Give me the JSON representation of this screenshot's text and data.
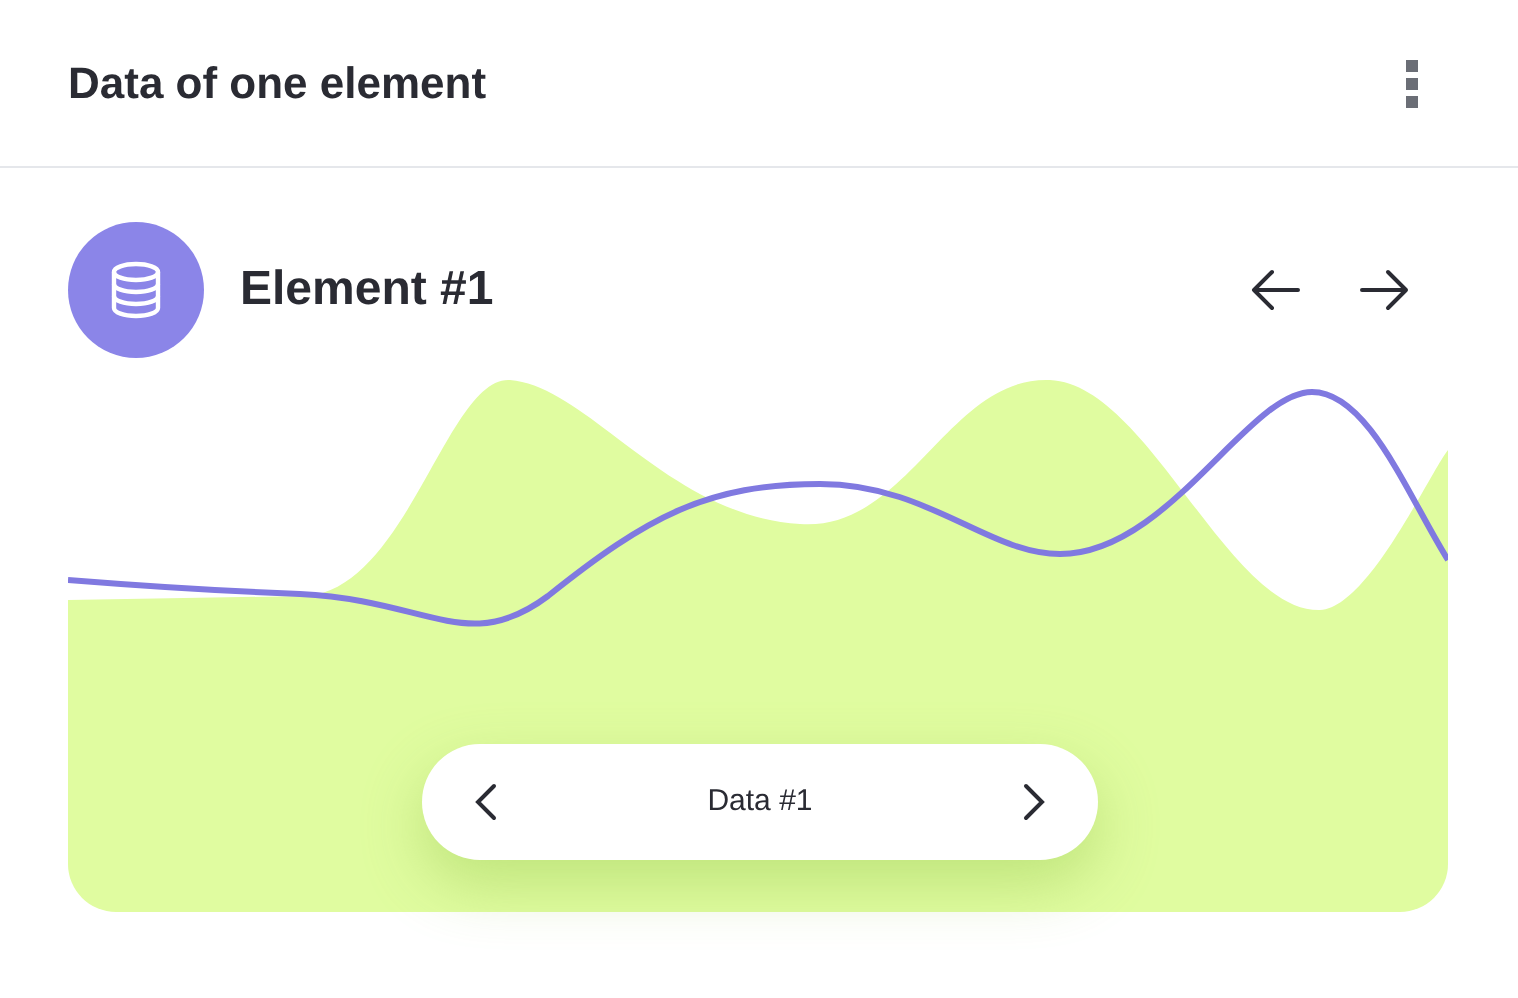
{
  "header": {
    "title": "Data of one element"
  },
  "element": {
    "title": "Element #1"
  },
  "pager": {
    "label": "Data #1"
  }
}
